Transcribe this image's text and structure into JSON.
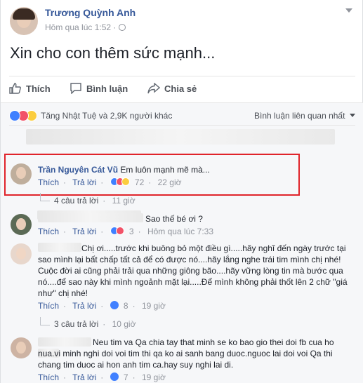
{
  "post": {
    "author": "Trương Quỳnh Anh",
    "time": "Hôm qua lúc 1:52",
    "time_sep": "·",
    "text": "Xin cho con thêm sức mạnh...",
    "menu_icon": "chevron-down-icon"
  },
  "actions": {
    "like": "Thích",
    "comment": "Bình luận",
    "share": "Chia sẻ"
  },
  "reactions_summary": {
    "text": "Tăng Nhật Tuệ và 2,9K người khác",
    "sort_label": "Bình luận liên quan nhất",
    "colors": {
      "like": "#4080ff",
      "love": "#f25268",
      "wow": "#fbcd3e"
    }
  },
  "comments": [
    {
      "author": "Trần Nguyên Cát Vũ",
      "text": "Em luôn mạnh mẽ mà...",
      "like": "Thích",
      "reply": "Trả lời",
      "count": "72",
      "time": "22 giờ",
      "replies_label": "4 câu trả lời",
      "replies_time": "11 giờ",
      "highlight_color": "#e0242b"
    },
    {
      "text": "Sao thế bé ơi ?",
      "like": "Thích",
      "reply": "Trả lời",
      "count": "3",
      "time": "Hôm qua lúc 7:33"
    },
    {
      "text": "Chị ơi.....trước khi buông bỏ một điều gì.....hãy nghĩ đến ngày trước tại sao mình lại bất chấp tất cả để có được nó....hãy lắng nghe trái tim mình chị nhé! Cuộc đời ai cũng phải trải qua những giông bão....hãy vững lòng tin mà bước qua nó....để sao này khi mình ngoảnh mặt lại.....Để mình không phải thốt lên 2 chữ \"giá như\" chị nhé!",
      "line1": "Chị ơi.....trước khi buông bỏ một điều gì.....hãy nghĩ đến ngày trước tại",
      "line2": "sao mình lại bất chấp tất cả để có được nó....hãy lắng nghe trái tim mình chị nhé!",
      "line3": "Cuộc đời ai cũng phải trải qua những giông bão....hãy vững lòng tin mà bước qua",
      "line4": "nó....để sao này khi mình ngoảnh mặt lại.....Để mình không phải thốt lên 2 chữ \"giá",
      "line5": "như\" chị nhé!",
      "like": "Thích",
      "reply": "Trả lời",
      "count": "8",
      "time": "19 giờ",
      "replies_label": "3 câu trả lời",
      "replies_time": "10 giờ"
    },
    {
      "line1": "Neu tim va Qa chia tay that minh se ko bao gio thei doi fb cua ho",
      "line2": "nua.vi minh nghi doi voi tim thi qa ko ai sanh bang duoc.nguoc lai doi voi Qa thi",
      "line3": "chang tim duoc ai hon anh tim ca.hay suy nghi lai di.",
      "like": "Thích",
      "reply": "Trả lời",
      "count": "7",
      "time": "19 giờ"
    }
  ],
  "dot": "·"
}
